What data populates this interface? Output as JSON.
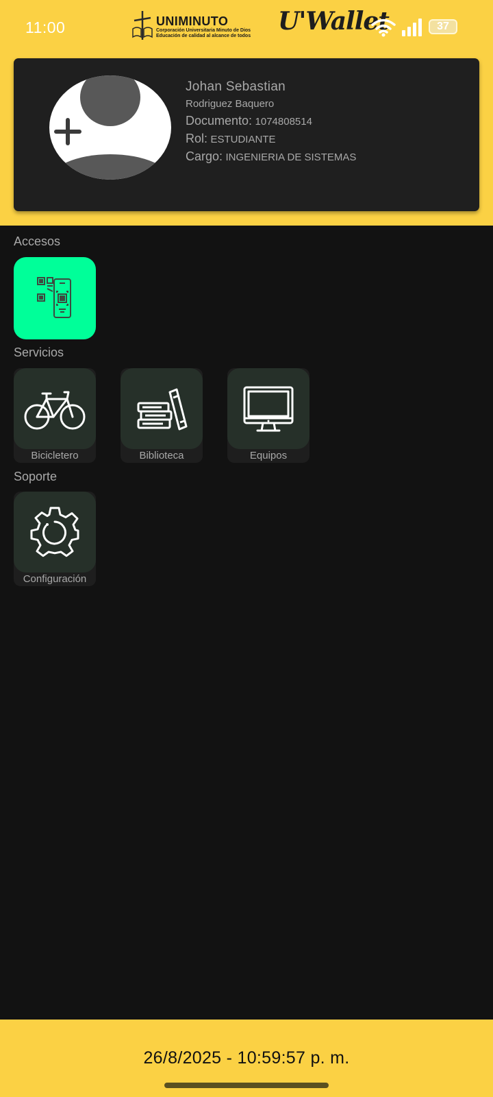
{
  "status_bar": {
    "time": "11:00",
    "battery": "37",
    "icons": [
      "wifi-icon",
      "signal-icon",
      "battery-icon"
    ]
  },
  "brand": {
    "logo_title": "UNIMINUTO",
    "logo_subtitle_1": "Corporación Universitaria Minuto de Dios",
    "logo_subtitle_2": "Educación de calidad al alcance de todos",
    "app_name": "U'Wallet"
  },
  "profile": {
    "first_name": "Johan Sebastian",
    "last_name": "Rodriguez Baquero",
    "document_label": "Documento:",
    "document_value": "1074808514",
    "role_label": "Rol:",
    "role_value": "ESTUDIANTE",
    "position_label": "Cargo:",
    "position_value": "INGENIERIA DE SISTEMAS"
  },
  "sections": {
    "access_title": "Accesos",
    "services_title": "Servicios",
    "support_title": "Soporte"
  },
  "services": [
    {
      "label": "Bicicletero",
      "icon": "bicycle-icon"
    },
    {
      "label": "Biblioteca",
      "icon": "books-icon"
    },
    {
      "label": "Equipos",
      "icon": "monitor-icon"
    }
  ],
  "support": [
    {
      "label": "Configuración",
      "icon": "gear-icon"
    }
  ],
  "access": [
    {
      "icon": "qr-scan-icon"
    }
  ],
  "footer": {
    "datetime": "26/8/2025 - 10:59:57 p. m."
  },
  "colors": {
    "brand_yellow": "#fbd144",
    "background": "#121212",
    "card": "#1f1f1f",
    "tile": "#263029",
    "access_green": "#00ff99",
    "text_muted": "#a9a9a9"
  }
}
